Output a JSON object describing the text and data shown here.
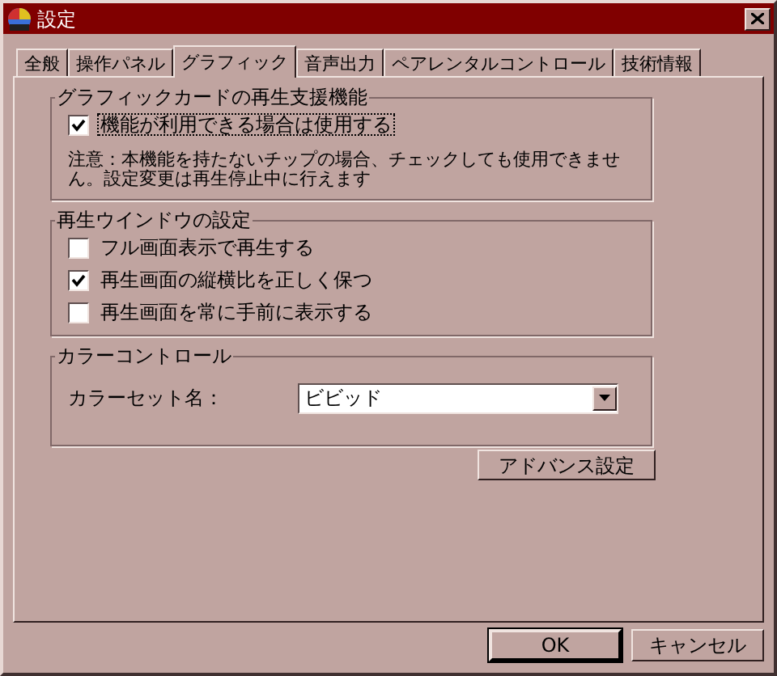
{
  "window": {
    "title": "設定"
  },
  "tabs": [
    {
      "label": "全般",
      "selected": false
    },
    {
      "label": "操作パネル",
      "selected": false
    },
    {
      "label": "グラフィック",
      "selected": true
    },
    {
      "label": "音声出力",
      "selected": false
    },
    {
      "label": "ペアレンタルコントロール",
      "selected": false
    },
    {
      "label": "技術情報",
      "selected": false
    }
  ],
  "groups": [
    {
      "title": "グラフィックカードの再生支援機能",
      "items": [
        {
          "label": "機能が利用できる場合は使用する",
          "checked": true,
          "focused": true
        }
      ],
      "note": "注意：本機能を持たないチップの場合、チェックしても使用できません。設定変更は再生停止中に行えます"
    },
    {
      "title": "再生ウインドウの設定",
      "items": [
        {
          "label": "フル画面表示で再生する",
          "checked": false,
          "focused": false
        },
        {
          "label": "再生画面の縦横比を正しく保つ",
          "checked": true,
          "focused": false
        },
        {
          "label": "再生画面を常に手前に表示する",
          "checked": false,
          "focused": false
        }
      ]
    },
    {
      "title": "カラーコントロール",
      "field": {
        "label": "カラーセット名：",
        "value": "ビビッド"
      }
    }
  ],
  "advanced_button": "アドバンス設定",
  "buttons": [
    {
      "label": "OK",
      "default": true
    },
    {
      "label": "キャンセル",
      "default": false
    }
  ]
}
